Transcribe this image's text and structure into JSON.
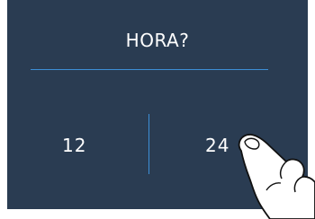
{
  "dialog": {
    "title": "HORA?",
    "options": [
      {
        "label": "12"
      },
      {
        "label": "24"
      }
    ]
  },
  "colors": {
    "background": "#2a3c52",
    "divider": "#3d8fd6",
    "text": "#ffffff"
  },
  "icons": {
    "pointer": "hand-pointer-icon"
  }
}
